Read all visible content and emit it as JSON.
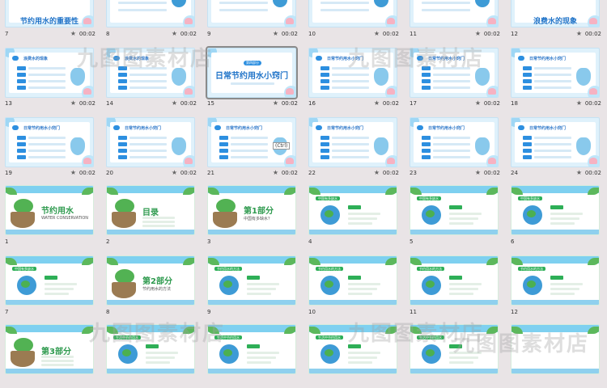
{
  "sections": [
    {
      "style": "blue",
      "rows": [
        {
          "slides": [
            {
              "number": "7",
              "duration": "00:02",
              "title": "节约用水的重要性"
            },
            {
              "number": "8",
              "duration": "00:02",
              "title": ""
            },
            {
              "number": "9",
              "duration": "00:02",
              "title": ""
            },
            {
              "number": "10",
              "duration": "00:02",
              "title": ""
            },
            {
              "number": "11",
              "duration": "00:02",
              "title": ""
            },
            {
              "number": "12",
              "duration": "00:02",
              "title": "浪费水的现象"
            }
          ]
        },
        {
          "slides": [
            {
              "number": "13",
              "duration": "00:02",
              "heading": "浪费水的现象"
            },
            {
              "number": "14",
              "duration": "00:02",
              "heading": "浪费水的现象"
            },
            {
              "number": "15",
              "duration": "00:02",
              "title": "日常节约用水小窍门",
              "tag": "第四部分",
              "selected": true
            },
            {
              "number": "16",
              "duration": "00:02",
              "heading": "日常节约用水小窍门"
            },
            {
              "number": "17",
              "duration": "00:02",
              "heading": "日常节约用水小窍门"
            },
            {
              "number": "18",
              "duration": "00:02",
              "heading": "日常节约用水小窍门"
            }
          ]
        },
        {
          "slides": [
            {
              "number": "19",
              "duration": "00:02",
              "heading": "日常节约用水小窍门"
            },
            {
              "number": "20",
              "duration": "00:02",
              "heading": "日常节约用水小窍门"
            },
            {
              "number": "21",
              "duration": "00:02",
              "heading": "日常节约用水小窍门",
              "badge": "(Ctrl)"
            },
            {
              "number": "22",
              "duration": "00:02",
              "heading": "日常节约用水小窍门"
            },
            {
              "number": "23",
              "duration": "00:02",
              "heading": "日常节约用水小窍门"
            },
            {
              "number": "24",
              "duration": "00:02",
              "heading": "日常节约用水小窍门"
            }
          ]
        }
      ]
    },
    {
      "style": "green",
      "rows": [
        {
          "slides": [
            {
              "number": "1",
              "big": "节约用水",
              "sub": "WATER CONSERVATION"
            },
            {
              "number": "2",
              "big": "目录"
            },
            {
              "number": "3",
              "big": "第1部分",
              "sub": "中国有多缺水？"
            },
            {
              "number": "4",
              "heading": "中国有多缺水"
            },
            {
              "number": "5",
              "heading": "中国有多缺水"
            },
            {
              "number": "6",
              "heading": "中国有多缺水"
            }
          ]
        },
        {
          "slides": [
            {
              "number": "7",
              "heading": "中国有多缺水"
            },
            {
              "number": "8",
              "big": "第2部分",
              "sub": "节约用水的方法"
            },
            {
              "number": "9",
              "heading": "节约用水的方法"
            },
            {
              "number": "10",
              "heading": "节约用水的方法"
            },
            {
              "number": "11",
              "heading": "节约用水的方法"
            },
            {
              "number": "12",
              "heading": "节约用水的方法"
            }
          ]
        },
        {
          "slides": [
            {
              "number": "",
              "big": "第3部分"
            },
            {
              "number": "",
              "heading": "生活中节约用水"
            },
            {
              "number": "",
              "heading": "生活中节约用水"
            },
            {
              "number": "",
              "heading": "生活中节约用水"
            },
            {
              "number": "",
              "heading": "生活中节约用水"
            },
            {
              "number": "",
              "heading": ""
            }
          ]
        }
      ]
    }
  ],
  "icons": {
    "star": "★"
  },
  "watermarks": [
    "九图图素材店",
    "九图图素材店",
    "九图图素材店",
    "九图图素材店",
    "九图图素材店"
  ],
  "colors": {
    "blue_accent": "#2d8fe0",
    "green_accent": "#2eaf57",
    "background": "#e9e4e6"
  }
}
